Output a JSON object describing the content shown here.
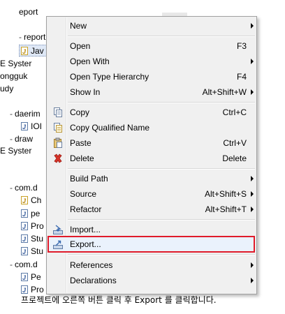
{
  "tree": {
    "rows": [
      {
        "text": "eport",
        "icon": "none",
        "twisty": ""
      },
      {
        "text": "report",
        "icon": "none",
        "twisty": "-"
      },
      {
        "text": "Jav",
        "icon": "java-file-warning",
        "twisty": ""
      },
      {
        "text": "E Syster",
        "icon": "none",
        "twisty": ""
      },
      {
        "text": "ongguk",
        "icon": "none",
        "twisty": ""
      },
      {
        "text": "udy",
        "icon": "none",
        "twisty": ""
      },
      {
        "text": "daerim",
        "icon": "none",
        "twisty": "-"
      },
      {
        "text": "IOI",
        "icon": "java-file",
        "twisty": ""
      },
      {
        "text": "draw",
        "icon": "none",
        "twisty": "-"
      },
      {
        "text": "E Syster",
        "icon": "none",
        "twisty": ""
      },
      {
        "text": "",
        "icon": "none",
        "twisty": ""
      },
      {
        "text": "com.d",
        "icon": "none",
        "twisty": "-"
      },
      {
        "text": "Ch",
        "icon": "java-file-warning",
        "twisty": ""
      },
      {
        "text": "pe",
        "icon": "java-file",
        "twisty": ""
      },
      {
        "text": "Pro",
        "icon": "java-file",
        "twisty": ""
      },
      {
        "text": "Stu",
        "icon": "java-file",
        "twisty": ""
      },
      {
        "text": "Stu",
        "icon": "java-file",
        "twisty": ""
      },
      {
        "text": "com.d",
        "icon": "none",
        "twisty": "-"
      },
      {
        "text": "Pe",
        "icon": "java-file",
        "twisty": ""
      },
      {
        "text": "Pro",
        "icon": "java-file",
        "twisty": ""
      }
    ]
  },
  "menu": {
    "new": {
      "label": "New",
      "shortcut": "",
      "submenu": true
    },
    "open": {
      "label": "Open",
      "shortcut": "F3",
      "submenu": false
    },
    "open_with": {
      "label": "Open With",
      "shortcut": "",
      "submenu": true
    },
    "open_type_hierarchy": {
      "label": "Open Type Hierarchy",
      "shortcut": "F4",
      "submenu": false
    },
    "show_in": {
      "label": "Show In",
      "shortcut": "Alt+Shift+W",
      "submenu": true
    },
    "copy": {
      "label": "Copy",
      "shortcut": "Ctrl+C",
      "icon": "copy-icon"
    },
    "copy_qualified_name": {
      "label": "Copy Qualified Name",
      "shortcut": "",
      "icon": "copy-qualified-name-icon"
    },
    "paste": {
      "label": "Paste",
      "shortcut": "Ctrl+V",
      "icon": "paste-icon"
    },
    "delete": {
      "label": "Delete",
      "shortcut": "Delete",
      "icon": "delete-icon"
    },
    "build_path": {
      "label": "Build Path",
      "shortcut": "",
      "submenu": true
    },
    "source": {
      "label": "Source",
      "shortcut": "Alt+Shift+S",
      "submenu": true
    },
    "refactor": {
      "label": "Refactor",
      "shortcut": "Alt+Shift+T",
      "submenu": true
    },
    "import": {
      "label": "Import...",
      "shortcut": "",
      "icon": "import-icon"
    },
    "export": {
      "label": "Export...",
      "shortcut": "",
      "icon": "export-icon",
      "highlighted": true
    },
    "references": {
      "label": "References",
      "shortcut": "",
      "submenu": true
    },
    "declarations": {
      "label": "Declarations",
      "shortcut": "",
      "submenu": true
    }
  },
  "colors": {
    "highlight_border": "#e01b2a",
    "menu_bg": "#f0f0f0"
  },
  "caption": "프로젝트에 오른쪽 버튼 클릭 후 Export 를 클릭합니다."
}
